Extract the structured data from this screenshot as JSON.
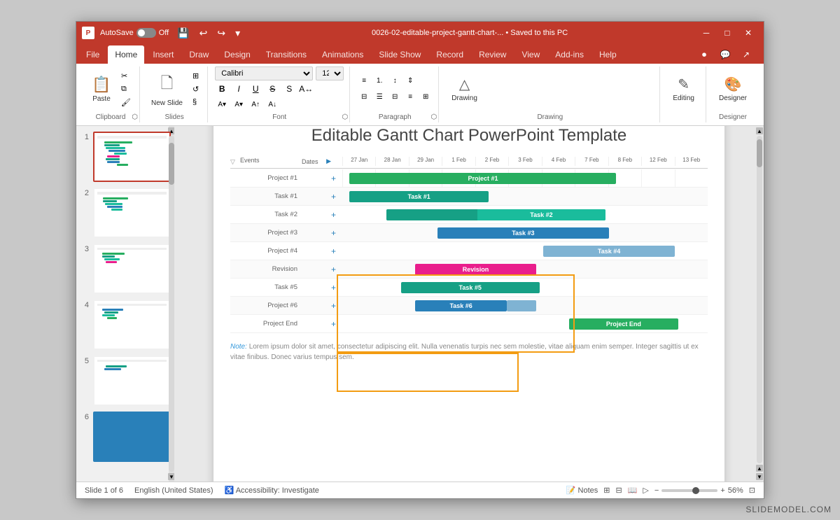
{
  "window": {
    "title": "0026-02-editable-project-gantt-chart-... • Saved to this PC",
    "autosave_label": "AutoSave",
    "autosave_state": "Off"
  },
  "ribbon": {
    "tabs": [
      "File",
      "Home",
      "Insert",
      "Draw",
      "Design",
      "Transitions",
      "Animations",
      "Slide Show",
      "Record",
      "Review",
      "View",
      "Add-ins",
      "Help"
    ],
    "active_tab": "Home",
    "groups": {
      "clipboard": "Clipboard",
      "slides": "Slides",
      "font": "Font",
      "paragraph": "Paragraph",
      "drawing": "Drawing",
      "editing": "Editing",
      "designer": "Designer"
    },
    "buttons": {
      "paste": "Paste",
      "new_slide": "New Slide",
      "drawing": "Drawing",
      "editing": "Editing",
      "designer": "Designer"
    }
  },
  "slide_panel": {
    "slides": [
      {
        "number": "1",
        "active": true
      },
      {
        "number": "2",
        "active": false
      },
      {
        "number": "3",
        "active": false
      },
      {
        "number": "4",
        "active": false
      },
      {
        "number": "5",
        "active": false
      },
      {
        "number": "6",
        "active": false
      }
    ]
  },
  "slide": {
    "title": "Editable Gantt Chart PowerPoint Template",
    "gantt": {
      "header_labels": [
        "Events",
        "Dates",
        "",
        "27 Jan",
        "28 Jan",
        "29 Jan",
        "1 Feb",
        "2 Feb",
        "3 Feb",
        "4 Feb",
        "7 Feb",
        "8 Feb",
        "12 Feb",
        "13 Feb"
      ],
      "rows": [
        {
          "label": "Project #1",
          "bar_text": "Project #1",
          "bar_color": "#27ae60",
          "bar_left": 1.5,
          "bar_width": 8.5
        },
        {
          "label": "Task #1",
          "bar_text": "Task #1",
          "bar_color": "#16a085",
          "bar_left": 1.5,
          "bar_width": 4.5
        },
        {
          "label": "Task #2",
          "bar_text": "Task #2",
          "bar_color": "#1abc9c",
          "bar_left": 2.5,
          "bar_width": 7.0
        },
        {
          "label": "Project #3",
          "bar_text": "Task #3",
          "bar_color": "#2980b9",
          "bar_left": 4.0,
          "bar_width": 5.5
        },
        {
          "label": "Project #4",
          "bar_text": "Task #4",
          "bar_color": "#7fb3d3",
          "bar_left": 6.5,
          "bar_width": 4.0
        },
        {
          "label": "Revision",
          "bar_text": "Revision",
          "bar_color": "#e91e8c",
          "bar_left": 3.5,
          "bar_width": 4.0
        },
        {
          "label": "Task #5",
          "bar_text": "Task #5",
          "bar_color": "#16a085",
          "bar_left": 3.0,
          "bar_width": 4.5
        },
        {
          "label": "Project #6",
          "bar_text": "Task #6",
          "bar_color": "#2980b9",
          "bar_left": 3.5,
          "bar_width": 4.0
        },
        {
          "label": "Project End",
          "bar_text": "Project End",
          "bar_color": "#27ae60",
          "bar_left": 7.5,
          "bar_width": 3.0
        }
      ]
    },
    "note": "Note: Lorem ipsum dolor sit amet, consectetur adipiscing elit. Nulla venenatis turpis nec sem molestie, vitae aliquam enim semper. Integer sagittis ut ex vitae finibus. Donec varius tempus sem."
  },
  "status_bar": {
    "slide_info": "Slide 1 of 6",
    "language": "English (United States)",
    "accessibility": "Accessibility: Investigate",
    "notes_label": "Notes",
    "zoom_level": "56%"
  },
  "watermark": "SLIDEMODEL.COM"
}
